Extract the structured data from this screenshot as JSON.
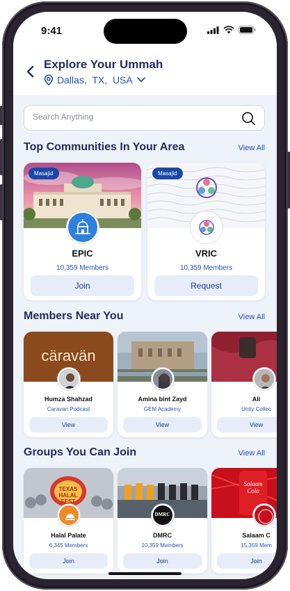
{
  "status": {
    "time": "9:41"
  },
  "header": {
    "title": "Explore Your Ummah",
    "location": "Dallas,  TX,  USA"
  },
  "search": {
    "placeholder": "Search Anything"
  },
  "communities": {
    "title": "Top Communities In Your Area",
    "view_all": "View All",
    "items": [
      {
        "badge": "Masajid",
        "name": "EPIC",
        "members": "10,359 Members",
        "action": "Join"
      },
      {
        "badge": "Masajid",
        "name": "VRIC",
        "members": "10,359 Members",
        "action": "Request"
      }
    ]
  },
  "members": {
    "title": "Members Near You",
    "view_all": "View All",
    "items": [
      {
        "banner_text": "cäravän",
        "name": "Humza Shahzad",
        "org": "Caravan Podcast",
        "action": "View"
      },
      {
        "name": "Amina bint Zayd",
        "org": "GEM Academy",
        "action": "View"
      },
      {
        "name": "Ali",
        "org": "Unity Collec",
        "action": "View"
      }
    ]
  },
  "groups": {
    "title": "Groups You Can Join",
    "view_all": "View All",
    "items": [
      {
        "name": "Halal Palate",
        "members": "6,345 Members",
        "action": "Join",
        "banner_text": "TEXAS HALAL FEST"
      },
      {
        "name": "DMRC",
        "members": "10,359 Members",
        "action": "Join",
        "logo_text": "DMRC"
      },
      {
        "name": "Salaam C",
        "members": "15,359 Mem",
        "action": "Join",
        "banner_text": "Salaam Cola"
      }
    ]
  },
  "colors": {
    "primary": "#1f2c5c",
    "accent": "#2253b5",
    "badge": "#1a48a6",
    "button_bg": "#e6edf8"
  }
}
